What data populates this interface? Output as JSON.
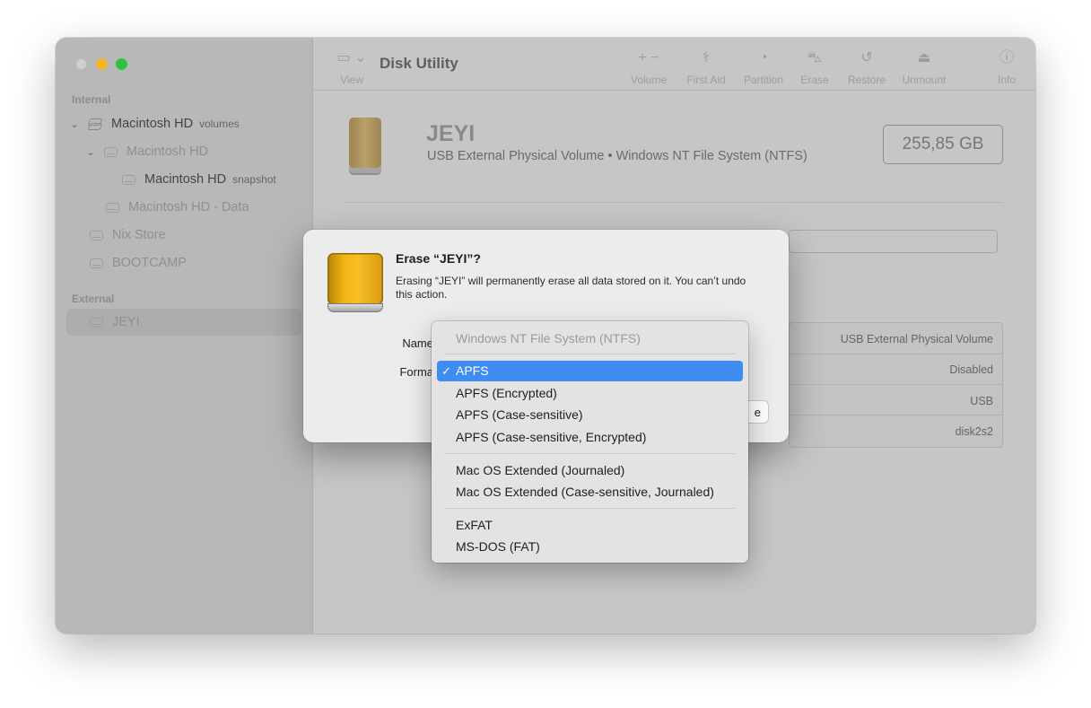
{
  "sidebar": {
    "section_internal": "Internal",
    "section_external": "External",
    "items": [
      {
        "label": "Macintosh HD",
        "sub": "volumes"
      },
      {
        "label": "Macintosh HD",
        "sub": ""
      },
      {
        "label": "Macintosh HD",
        "sub": "snapshot"
      },
      {
        "label": "Macintosh HD - Data",
        "sub": ""
      },
      {
        "label": "Nix Store",
        "sub": ""
      },
      {
        "label": "BOOTCAMP",
        "sub": ""
      },
      {
        "label": "JEYI",
        "sub": ""
      }
    ]
  },
  "toolbar": {
    "title": "Disk Utility",
    "view_label": "View",
    "buttons": [
      {
        "label": "Volume",
        "glyph": "+ −"
      },
      {
        "label": "First Aid",
        "glyph": "⚕"
      },
      {
        "label": "Partition",
        "glyph": "◔"
      },
      {
        "label": "Erase",
        "glyph": "⛍"
      },
      {
        "label": "Restore",
        "glyph": "↺"
      },
      {
        "label": "Unmount",
        "glyph": "⏏"
      },
      {
        "label": "Info",
        "glyph": "ⓘ"
      }
    ]
  },
  "drive": {
    "name": "JEYI",
    "subtitle": "USB External Physical Volume • Windows NT File System (NTFS)",
    "capacity": "255,85 GB"
  },
  "info": {
    "rows": [
      "USB External Physical Volume",
      "Disabled",
      "USB",
      "disk2s2"
    ]
  },
  "dialog": {
    "title": "Erase “JEYI”?",
    "message": "Erasing “JEYI” will permanently erase all data stored on it. You can’t undo this action.",
    "name_label": "Name",
    "format_label": "Forma",
    "button_edge": "e"
  },
  "menu": {
    "header": "Windows NT File System (NTFS)",
    "check": "✓",
    "group1": [
      "APFS",
      "APFS (Encrypted)",
      "APFS (Case-sensitive)",
      "APFS (Case-sensitive, Encrypted)"
    ],
    "group2": [
      "Mac OS Extended (Journaled)",
      "Mac OS Extended (Case-sensitive, Journaled)"
    ],
    "group3": [
      "ExFAT",
      "MS-DOS (FAT)"
    ],
    "selected": "APFS"
  },
  "colors": {
    "accent": "#3f8cf2",
    "drive_gold": "#f3b317",
    "traffic_min": "#f5b52c",
    "traffic_max": "#2fc23f"
  }
}
